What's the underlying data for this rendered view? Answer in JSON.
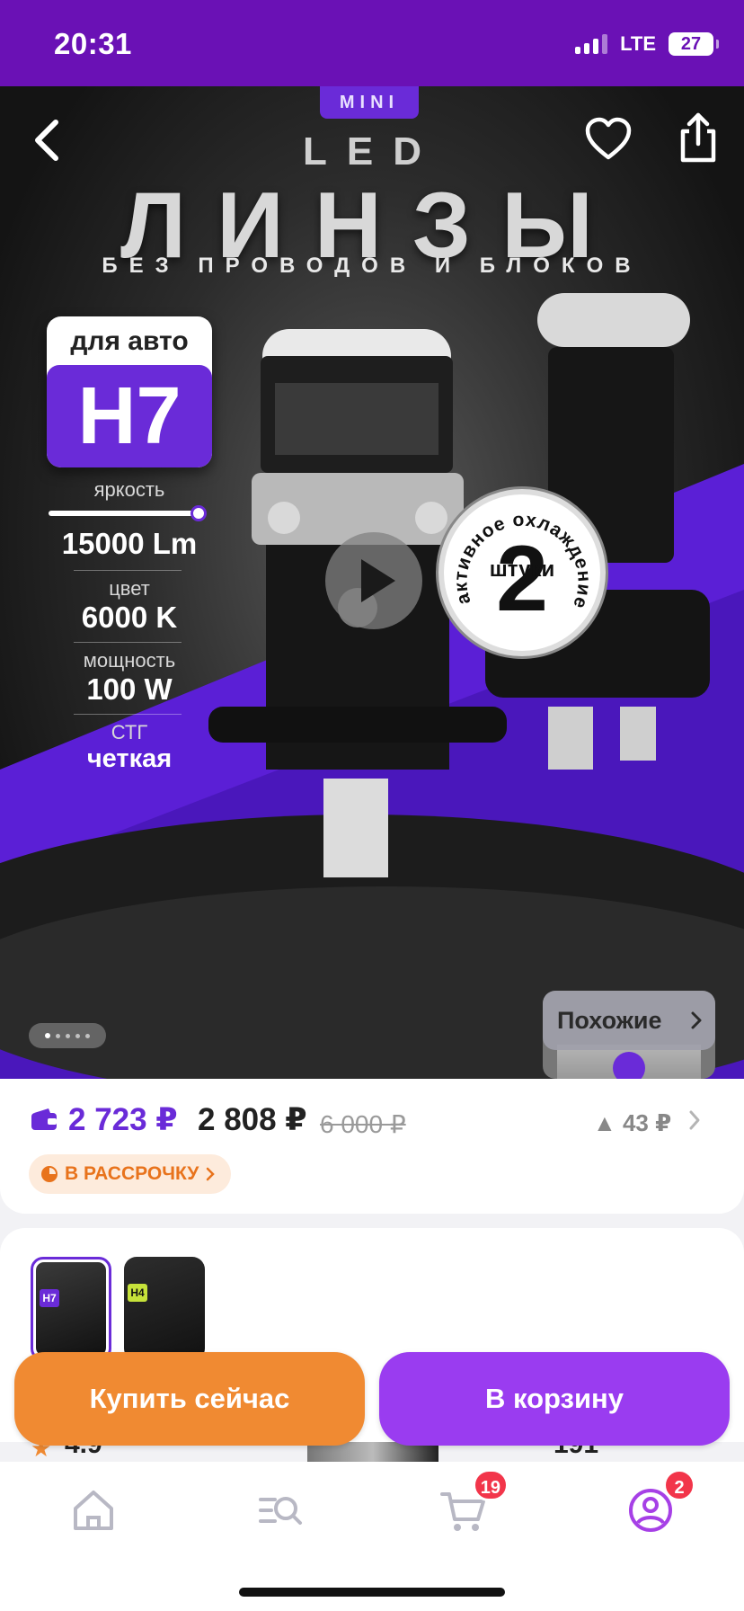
{
  "status_bar": {
    "time": "20:31",
    "network": "LTE",
    "battery": "27"
  },
  "hero": {
    "badge_mini": "MINI",
    "led": "LED",
    "title": "ЛИНЗЫ",
    "subtitle": "БЕЗ ПРОВОДОВ И БЛОКОВ",
    "car_label": "для авто",
    "car_model": "H7",
    "specs": [
      {
        "label": "яркость",
        "value": "15000 Lm"
      },
      {
        "label": "цвет",
        "value": "6000 K"
      },
      {
        "label": "мощность",
        "value": "100 W"
      },
      {
        "label": "СТГ",
        "value": "четкая"
      }
    ],
    "brightness_level": 0.95,
    "cooling_ring_text": "активное охлаждение",
    "pieces_number": "2",
    "pieces_label": "штуки",
    "similar_label": "Похожие",
    "gallery_dots": 5
  },
  "price": {
    "wallet_price": "2 723 ₽",
    "regular_price": "2 808 ₽",
    "old_price": "6 000 ₽",
    "delta": "▲ 43 ₽",
    "installment": "В РАССРОЧКУ"
  },
  "variants": [
    {
      "tag": "H7",
      "selected": true
    },
    {
      "tag": "H4",
      "selected": false
    }
  ],
  "actions": {
    "buy_now": "Купить сейчас",
    "add_to_cart": "В корзину"
  },
  "peek": {
    "rating": "4.9",
    "count": "191"
  },
  "tab_bar": {
    "items": [
      {
        "name": "home",
        "icon": "home-icon"
      },
      {
        "name": "catalog",
        "icon": "catalog-search-icon"
      },
      {
        "name": "cart",
        "icon": "cart-icon",
        "badge": "19"
      },
      {
        "name": "profile",
        "icon": "profile-icon",
        "badge": "2"
      }
    ]
  },
  "colors": {
    "brand_purple": "#6a2bd8",
    "status_purple": "#6a11b5",
    "orange": "#f08a32",
    "cart_purple": "#9a3cf0",
    "badge_red": "#f2354a"
  }
}
